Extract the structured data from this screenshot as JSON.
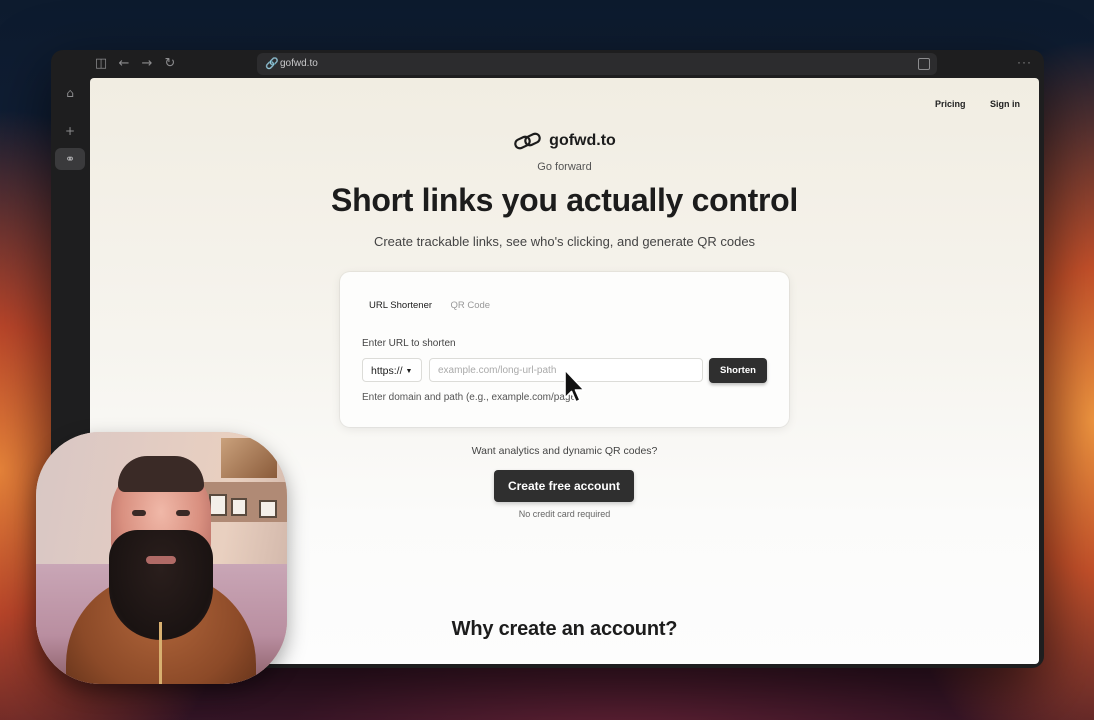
{
  "browser": {
    "url": "gofwd.to"
  },
  "nav": {
    "pricing": "Pricing",
    "sign_in": "Sign in"
  },
  "brand": {
    "name": "gofwd.to",
    "tagline": "Go forward"
  },
  "hero": {
    "title": "Short links you actually control",
    "subtitle": "Create trackable links, see who's clicking, and generate QR codes"
  },
  "shortener": {
    "tabs": [
      "URL Shortener",
      "QR Code"
    ],
    "active_tab": "URL Shortener",
    "field_label": "Enter URL to shorten",
    "scheme": "https://",
    "placeholder": "example.com/long-url-path",
    "value": "",
    "button": "Shorten",
    "hint": "Enter domain and path (e.g., example.com/page)"
  },
  "promo": {
    "text": "Want analytics and dynamic QR codes?",
    "cta": "Create free account",
    "note": "No credit card required"
  },
  "section": {
    "title": "Why create an account?"
  },
  "colors": {
    "primary_button": "#2f2f2f",
    "page_bg_top": "#f1ede2",
    "text": "#1c1c1c"
  }
}
